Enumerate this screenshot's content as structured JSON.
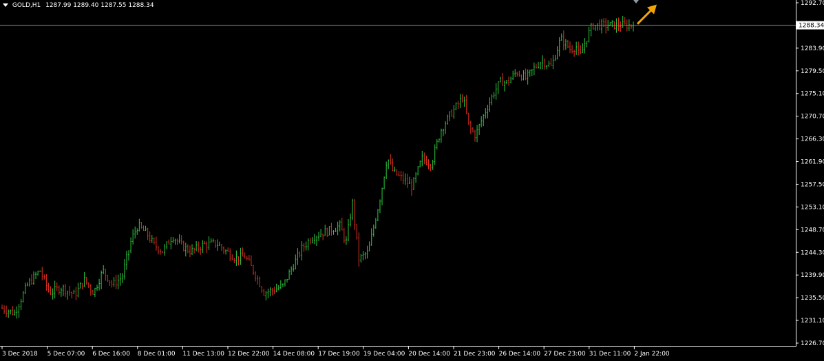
{
  "header": {
    "symbol": "GOLD,H1",
    "ohlc": "1287.99 1289.40 1287.55 1288.34"
  },
  "colors": {
    "background": "#000000",
    "bull": "#2ecc40",
    "bear": "#e03020",
    "axis": "#ffffff",
    "price_line": "#8c8c8c",
    "arrow": "#f2a500"
  },
  "chart_data": {
    "type": "candlestick",
    "y_ticks": [
      1292.7,
      1283.9,
      1279.5,
      1275.1,
      1270.7,
      1266.3,
      1261.9,
      1257.5,
      1253.1,
      1248.7,
      1244.3,
      1239.9,
      1235.5,
      1231.1,
      1226.7
    ],
    "ylim": [
      1226.7,
      1292.7
    ],
    "current_price": "1288.34",
    "x_labels": [
      "3 Dec 2018",
      "5 Dec 07:00",
      "6 Dec 16:00",
      "8 Dec 01:00",
      "11 Dec 13:00",
      "12 Dec 22:00",
      "14 Dec 08:00",
      "17 Dec 19:00",
      "19 Dec 04:00",
      "20 Dec 14:00",
      "21 Dec 23:00",
      "26 Dec 14:00",
      "27 Dec 23:00",
      "31 Dec 11:00",
      "2 Jan 22:00"
    ],
    "close_path": [
      [
        0,
        1233.5
      ],
      [
        0.02,
        1232.5
      ],
      [
        0.04,
        1238
      ],
      [
        0.06,
        1240.8
      ],
      [
        0.075,
        1236.5
      ],
      [
        0.095,
        1237.5
      ],
      [
        0.115,
        1236.0
      ],
      [
        0.13,
        1239.0
      ],
      [
        0.145,
        1236.5
      ],
      [
        0.16,
        1240.8
      ],
      [
        0.175,
        1238.0
      ],
      [
        0.19,
        1239.5
      ],
      [
        0.205,
        1246.8
      ],
      [
        0.215,
        1249.5
      ],
      [
        0.23,
        1247.8
      ],
      [
        0.24,
        1245.8
      ],
      [
        0.255,
        1244.5
      ],
      [
        0.27,
        1247.5
      ],
      [
        0.285,
        1245.5
      ],
      [
        0.3,
        1244.5
      ],
      [
        0.32,
        1245.8
      ],
      [
        0.34,
        1246.0
      ],
      [
        0.355,
        1244.5
      ],
      [
        0.37,
        1243.2
      ],
      [
        0.385,
        1243.5
      ],
      [
        0.4,
        1240.3
      ],
      [
        0.415,
        1236.5
      ],
      [
        0.43,
        1237.0
      ],
      [
        0.445,
        1237.8
      ],
      [
        0.46,
        1241.5
      ],
      [
        0.475,
        1245.0
      ],
      [
        0.49,
        1247.2
      ],
      [
        0.505,
        1248.0
      ],
      [
        0.52,
        1248.6
      ],
      [
        0.535,
        1249.5
      ],
      [
        0.545,
        1246.2
      ],
      [
        0.555,
        1254.0
      ],
      [
        0.565,
        1243.0
      ],
      [
        0.58,
        1244.3
      ],
      [
        0.59,
        1250.0
      ],
      [
        0.6,
        1255.5
      ],
      [
        0.61,
        1262.8
      ],
      [
        0.62,
        1259.8
      ],
      [
        0.635,
        1258.5
      ],
      [
        0.65,
        1257.0
      ],
      [
        0.665,
        1262.5
      ],
      [
        0.68,
        1261.5
      ],
      [
        0.695,
        1268.0
      ],
      [
        0.71,
        1271.0
      ],
      [
        0.725,
        1273.5
      ],
      [
        0.73,
        1274.5
      ],
      [
        0.74,
        1268.5
      ],
      [
        0.75,
        1267.0
      ],
      [
        0.765,
        1271.5
      ],
      [
        0.78,
        1275.5
      ],
      [
        0.79,
        1277.5
      ],
      [
        0.8,
        1277.2
      ],
      [
        0.815,
        1279.3
      ],
      [
        0.83,
        1278.0
      ],
      [
        0.845,
        1280.3
      ],
      [
        0.855,
        1281.5
      ],
      [
        0.87,
        1280.3
      ],
      [
        0.885,
        1285.8
      ],
      [
        0.9,
        1283.7
      ],
      [
        0.91,
        1284.2
      ],
      [
        0.915,
        1282.0
      ],
      [
        0.925,
        1285.5
      ],
      [
        0.935,
        1288.34
      ]
    ]
  }
}
